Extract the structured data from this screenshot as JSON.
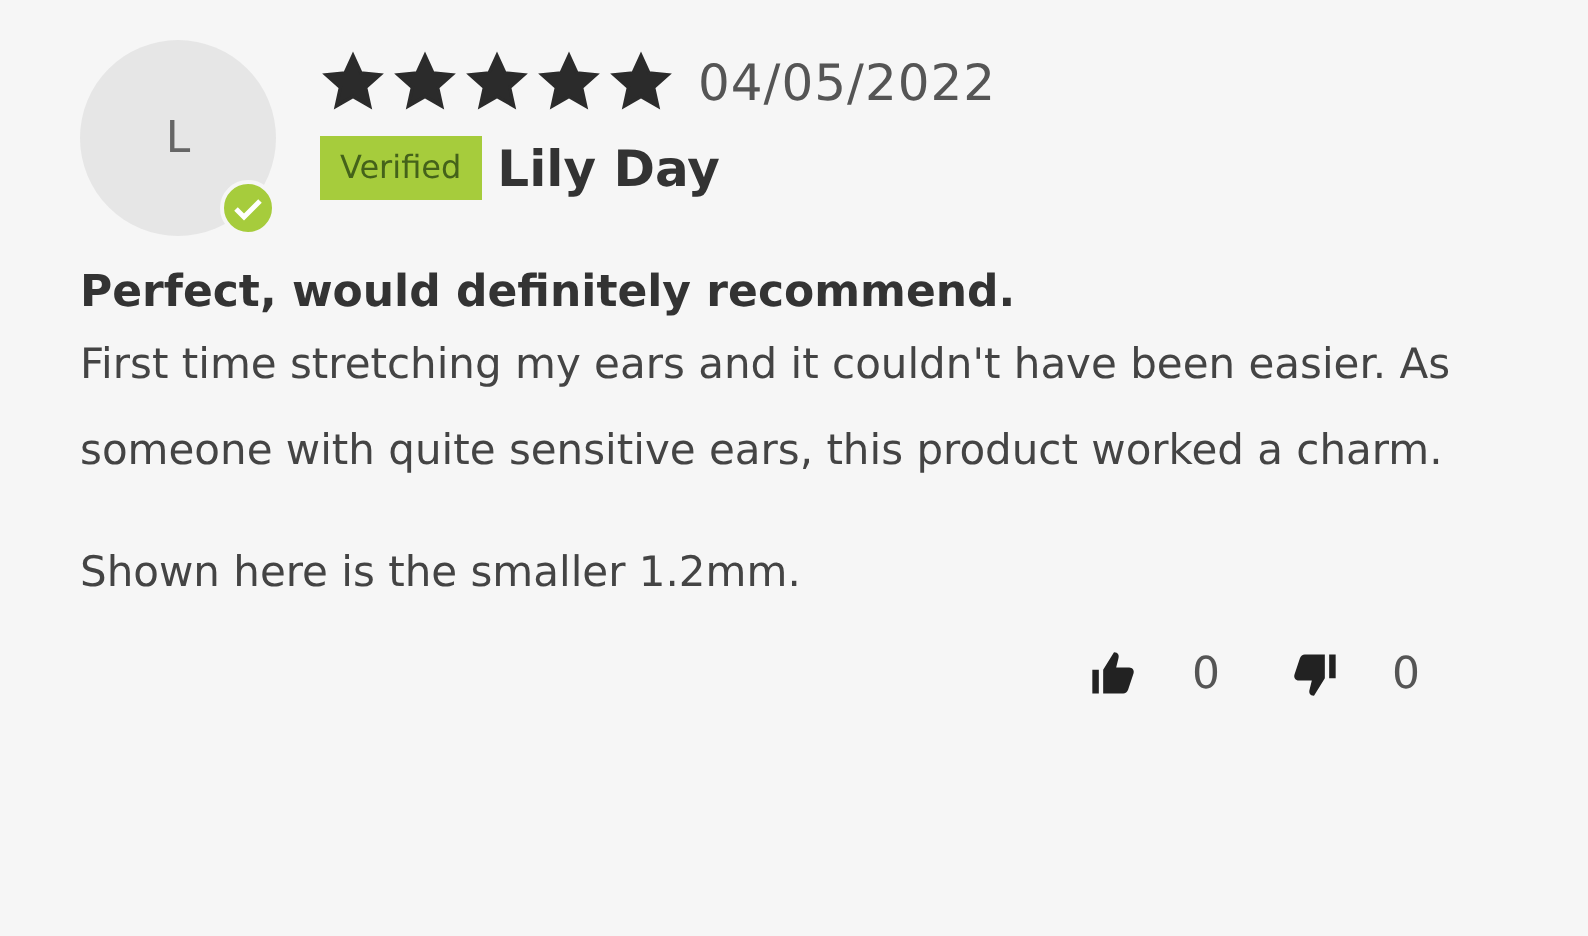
{
  "review": {
    "avatar_initial": "L",
    "verified": true,
    "stars": 5,
    "date": "04/05/2022",
    "badge": "Verified",
    "author": "Lily Day",
    "title": "Perfect, would definitely recommend.",
    "paragraphs": [
      "First time stretching my ears and it couldn't have been easier. As someone with quite sensitive ears, this product worked a charm.",
      "Shown here is the smaller 1.2mm."
    ],
    "votes": [
      {
        "kind": "up",
        "count": "0"
      },
      {
        "kind": "down",
        "count": "0"
      }
    ]
  }
}
